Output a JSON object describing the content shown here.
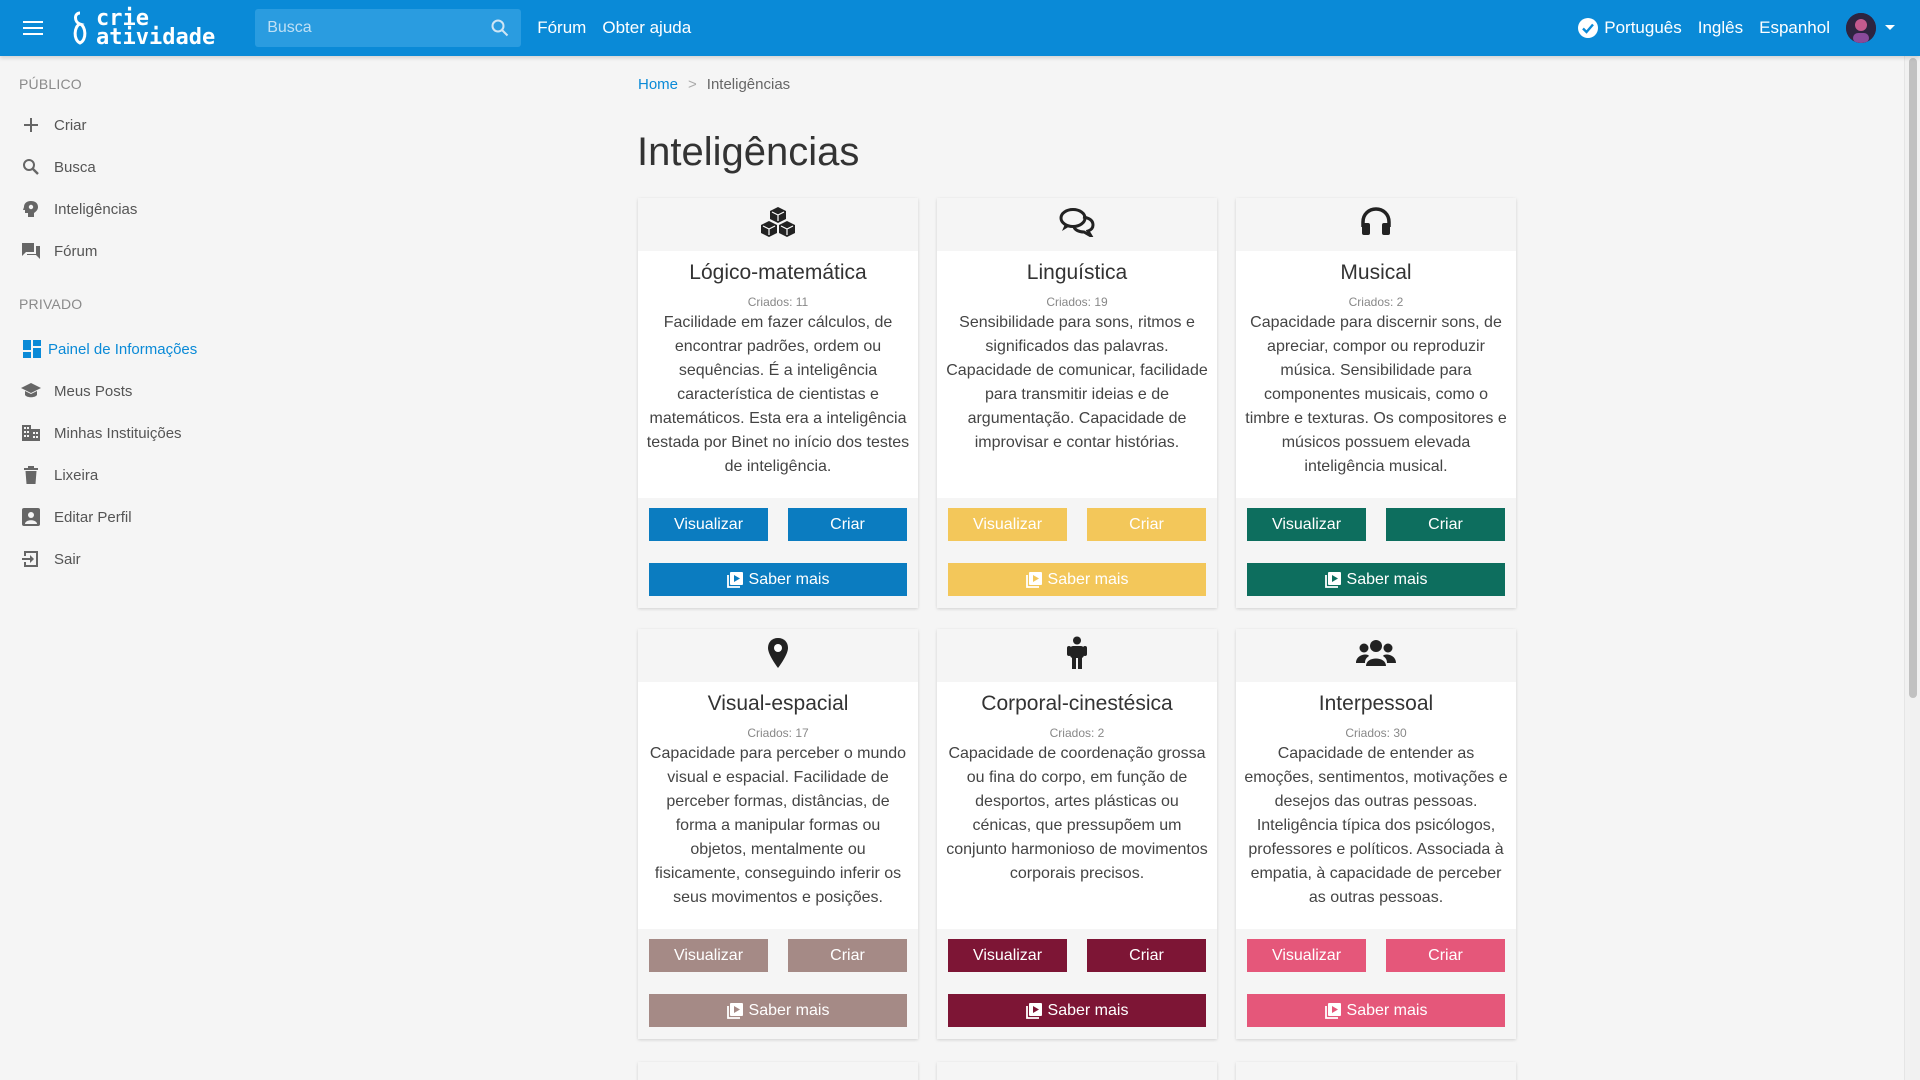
{
  "header": {
    "logo_line1": "crie",
    "logo_line2": "atividade",
    "search_placeholder": "Busca",
    "links": [
      "Fórum",
      "Obter ajuda"
    ],
    "languages": [
      "Português",
      "Inglês",
      "Espanhol"
    ],
    "bar_color": "#0a8ad7"
  },
  "sidebar": {
    "public_title": "PÚBLICO",
    "public_items": [
      {
        "label": "Criar",
        "icon": "plus-icon"
      },
      {
        "label": "Busca",
        "icon": "search-icon"
      },
      {
        "label": "Inteligências",
        "icon": "brain-icon"
      },
      {
        "label": "Fórum",
        "icon": "forum-icon"
      }
    ],
    "private_title": "PRIVADO",
    "private_items": [
      {
        "label": "Painel de Informações",
        "icon": "dashboard-icon",
        "active": true
      },
      {
        "label": "Meus Posts",
        "icon": "school-icon"
      },
      {
        "label": "Minhas Instituições",
        "icon": "building-icon"
      },
      {
        "label": "Lixeira",
        "icon": "trash-icon"
      },
      {
        "label": "Editar Perfil",
        "icon": "profile-icon"
      },
      {
        "label": "Sair",
        "icon": "logout-icon"
      }
    ]
  },
  "breadcrumb": {
    "home": "Home",
    "separator": ">",
    "current": "Inteligências"
  },
  "page_title": "Inteligências",
  "buttons": {
    "view": "Visualizar",
    "create": "Criar",
    "more": "Saber mais"
  },
  "cards": [
    {
      "title": "Lógico-matemática",
      "count": "Criados: 11",
      "icon": "cubes-icon",
      "color": "#0b7cc0",
      "desc": "Facilidade em fazer cálculos, de encontrar padrões, ordem ou sequências. É a inteligência característica de cientistas e matemáticos. Esta era a inteligência testada por Binet no início dos testes de inteligência."
    },
    {
      "title": "Linguística",
      "count": "Criados: 19",
      "icon": "chat-icon",
      "color": "#f3c75a",
      "desc": "Sensibilidade para sons, ritmos e significados das palavras. Capacidade de comunicar, facilidade para transmitir ideias e de argumentação. Capacidade de improvisar e contar histórias."
    },
    {
      "title": "Musical",
      "count": "Criados: 2",
      "icon": "headphones-icon",
      "color": "#0d6e5e",
      "desc": "Capacidade para discernir sons, de apreciar, compor ou reproduzir música. Sensibilidade para componentes musicais, como o timbre e texturas. Os compositores e músicos possuem elevada inteligência musical."
    },
    {
      "title": "Visual-espacial",
      "count": "Criados: 17",
      "icon": "map-pin-icon",
      "color": "#a58a86",
      "desc": "Capacidade para perceber o mundo visual e espacial. Facilidade de perceber formas, distâncias, de forma a manipular formas ou objetos, mentalmente ou fisicamente, conseguindo inferir os seus movimentos e posições."
    },
    {
      "title": "Corporal-cinestésica",
      "count": "Criados: 2",
      "icon": "person-icon",
      "color": "#7d1535",
      "desc": "Capacidade de coordenação grossa ou fina do corpo, em função de desportos, artes plásticas ou cénicas, que pressupõem um conjunto harmonioso de movimentos corporais precisos."
    },
    {
      "title": "Interpessoal",
      "count": "Criados: 30",
      "icon": "users-icon",
      "color": "#e5577a",
      "desc": "Capacidade de entender as emoções, sentimentos, motivações e desejos das outras pessoas. Inteligência típica dos psicólogos, professores e políticos. Associada à empatia, à capacidade de perceber as outras pessoas."
    }
  ]
}
